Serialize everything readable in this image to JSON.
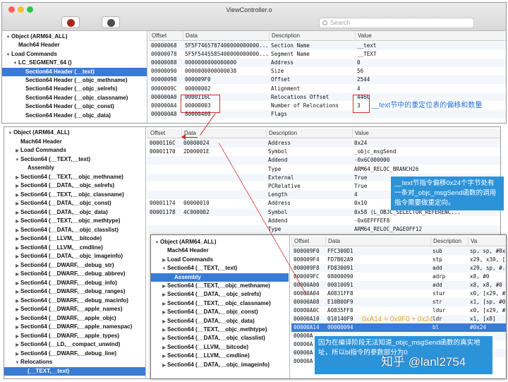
{
  "window": {
    "title": "ViewController.o",
    "search_placeholder": "Search"
  },
  "panel1": {
    "tree": [
      {
        "label": "Object (ARM64_ALL)",
        "arrow": "▼",
        "indent": 0
      },
      {
        "label": "Mach64 Header",
        "arrow": "",
        "indent": 1
      },
      {
        "label": "Load Commands",
        "arrow": "▼",
        "indent": 0
      },
      {
        "label": "LC_SEGMENT_64 ()",
        "arrow": "▼",
        "indent": 1
      },
      {
        "label": "Section64 Header (__text)",
        "arrow": "",
        "indent": 2,
        "selected": true
      },
      {
        "label": "Section64 Header (__objc_methname)",
        "arrow": "",
        "indent": 2
      },
      {
        "label": "Section64 Header (__objc_selrefs)",
        "arrow": "",
        "indent": 2
      },
      {
        "label": "Section64 Header (__objc_classname)",
        "arrow": "",
        "indent": 2
      },
      {
        "label": "Section64 Header (__objc_const)",
        "arrow": "",
        "indent": 2
      },
      {
        "label": "Section64 Header (__objc_data)",
        "arrow": "",
        "indent": 2
      }
    ],
    "columns": [
      "Offset",
      "Data",
      "Description",
      "Value"
    ],
    "rows": [
      [
        "00000068",
        "5F5F7465787400000000000...",
        "Section Name",
        "__text"
      ],
      [
        "00000078",
        "5F5F5445585400000000000...",
        "Segment Name",
        "__TEXT"
      ],
      [
        "00000088",
        "0000000000000000",
        "Address",
        "0"
      ],
      [
        "00000090",
        "0000000000000038",
        "Size",
        "56"
      ],
      [
        "00000098",
        "000009F0",
        "Offset",
        "2544"
      ],
      [
        "0000009C",
        "00000002",
        "Alignment",
        "4"
      ],
      [
        "000000A0",
        "0000116C",
        "Relocations Offset",
        "4460"
      ],
      [
        "000000A4",
        "00000003",
        "Number of Relocations",
        "3"
      ],
      [
        "000000A8",
        "80000400",
        "Flags",
        ""
      ]
    ]
  },
  "panel2": {
    "tree": [
      {
        "label": "Object (ARM64_ALL)",
        "arrow": "▼",
        "indent": 0
      },
      {
        "label": "Mach64 Header",
        "arrow": "",
        "indent": 1
      },
      {
        "label": "Load Commands",
        "arrow": "▶",
        "indent": 1
      },
      {
        "label": "Section64 (__TEXT,__text)",
        "arrow": "▼",
        "indent": 1
      },
      {
        "label": "Assembly",
        "arrow": "",
        "indent": 2
      },
      {
        "label": "Section64 (__TEXT,__objc_methname)",
        "arrow": "▶",
        "indent": 1
      },
      {
        "label": "Section64 (__DATA,__objc_selrefs)",
        "arrow": "▶",
        "indent": 1
      },
      {
        "label": "Section64 (__TEXT,__objc_classname)",
        "arrow": "▶",
        "indent": 1
      },
      {
        "label": "Section64 (__DATA,__objc_const)",
        "arrow": "▶",
        "indent": 1
      },
      {
        "label": "Section64 (__DATA,__objc_data)",
        "arrow": "▶",
        "indent": 1
      },
      {
        "label": "Section64 (__TEXT,__objc_methtype)",
        "arrow": "▶",
        "indent": 1
      },
      {
        "label": "Section64 (__DATA,__objc_classlist)",
        "arrow": "▶",
        "indent": 1
      },
      {
        "label": "Section64 (__LLVM,__bitcode)",
        "arrow": "▶",
        "indent": 1
      },
      {
        "label": "Section64 (__LLVM,__cmdline)",
        "arrow": "▶",
        "indent": 1
      },
      {
        "label": "Section64 (__DATA,__objc_imageinfo)",
        "arrow": "▶",
        "indent": 1
      },
      {
        "label": "Section64 (__DWARF,__debug_str)",
        "arrow": "▶",
        "indent": 1
      },
      {
        "label": "Section64 (__DWARF,__debug_abbrev)",
        "arrow": "▶",
        "indent": 1
      },
      {
        "label": "Section64 (__DWARF,__debug_info)",
        "arrow": "▶",
        "indent": 1
      },
      {
        "label": "Section64 (__DWARF,__debug_ranges)",
        "arrow": "▶",
        "indent": 1
      },
      {
        "label": "Section64 (__DWARF,__debug_macinfo)",
        "arrow": "▶",
        "indent": 1
      },
      {
        "label": "Section64 (__DWARF,__apple_names)",
        "arrow": "▶",
        "indent": 1
      },
      {
        "label": "Section64 (__DWARF,__apple_objc)",
        "arrow": "▶",
        "indent": 1
      },
      {
        "label": "Section64 (__DWARF,__apple_namespac)",
        "arrow": "▶",
        "indent": 1
      },
      {
        "label": "Section64 (__DWARF,__apple_types)",
        "arrow": "▶",
        "indent": 1
      },
      {
        "label": "Section64 (__LD,__compact_unwind)",
        "arrow": "▶",
        "indent": 1
      },
      {
        "label": "Section64 (__DWARF,__debug_line)",
        "arrow": "▶",
        "indent": 1
      },
      {
        "label": "Relocations",
        "arrow": "▼",
        "indent": 1
      },
      {
        "label": "(__TEXT,__text)",
        "arrow": "",
        "indent": 2,
        "selected": true
      }
    ],
    "columns": [
      "Offset",
      "Data",
      "Description",
      "Value"
    ],
    "rows": [
      [
        "0000116C",
        "00000024",
        "Address",
        "0x24"
      ],
      [
        "00001170",
        "2D00001E",
        "Symbol",
        "_objc_msgSend"
      ],
      [
        "",
        "",
        "Addend",
        "-0x6C000000"
      ],
      [
        "",
        "",
        "Type",
        "ARM64_RELOC_BRANCH26"
      ],
      [
        "",
        "",
        "External",
        "True"
      ],
      [
        "",
        "",
        "PCRelative",
        "True"
      ],
      [
        "",
        "",
        "Length",
        "4"
      ],
      [
        "00001174",
        "00000010",
        "Address",
        "0x10"
      ],
      [
        "00001178",
        "4C000002",
        "Symbol",
        "0x58 (L_OBJC_SELECTOR_REFERENC..."
      ],
      [
        "",
        "",
        "Addend",
        "-0x6EFFFEF8"
      ],
      [
        "",
        "",
        "Type",
        "ARM64_RELOC_PAGEOFF12"
      ]
    ]
  },
  "panel3": {
    "tree": [
      {
        "label": "Object (ARM64_ALL)",
        "arrow": "▼",
        "indent": 0
      },
      {
        "label": "Mach64 Header",
        "arrow": "",
        "indent": 1
      },
      {
        "label": "Load Commands",
        "arrow": "▶",
        "indent": 1
      },
      {
        "label": "Section64 (__TEXT,__text)",
        "arrow": "▼",
        "indent": 1
      },
      {
        "label": "Assembly",
        "arrow": "",
        "indent": 2,
        "selected": true
      },
      {
        "label": "Section64 (__TEXT,__objc_methname)",
        "arrow": "▶",
        "indent": 1
      },
      {
        "label": "Section64 (__DATA,__objc_selrefs)",
        "arrow": "▶",
        "indent": 1
      },
      {
        "label": "Section64 (__TEXT,__objc_classname)",
        "arrow": "▶",
        "indent": 1
      },
      {
        "label": "Section64 (__DATA,__objc_const)",
        "arrow": "▶",
        "indent": 1
      },
      {
        "label": "Section64 (__DATA,__objc_data)",
        "arrow": "▶",
        "indent": 1
      },
      {
        "label": "Section64 (__TEXT,__objc_methtype)",
        "arrow": "▶",
        "indent": 1
      },
      {
        "label": "Section64 (__DATA,__objc_classlist)",
        "arrow": "▶",
        "indent": 1
      },
      {
        "label": "Section64 (__LLVM,__bitcode)",
        "arrow": "▶",
        "indent": 1
      },
      {
        "label": "Section64 (__LLVM,__cmdline)",
        "arrow": "▶",
        "indent": 1
      },
      {
        "label": "Section64 (__DATA,__objc_imageinfo)",
        "arrow": "▶",
        "indent": 1
      }
    ],
    "columns": [
      "Offset",
      "Data",
      "Description",
      "Va"
    ],
    "rows": [
      [
        "000009F0",
        "FFC300D1",
        "sub",
        "sp, sp, #0x..."
      ],
      [
        "000009F4",
        "FD7B02A9",
        "stp",
        "x29, x30, [..."
      ],
      [
        "000009F8",
        "FD830091",
        "add",
        "x29, sp, #..."
      ],
      [
        "000009FC",
        "08000090",
        "adrp",
        "x8, #0"
      ],
      [
        "00000A00",
        "00010091",
        "add",
        "x8, x8, #0"
      ],
      [
        "00000A04",
        "A0831FF8",
        "stur",
        "x0, [x29, #..."
      ],
      [
        "00000A08",
        "E10B00F9",
        "str",
        "x1, [sp, #0..."
      ],
      [
        "00000A0C",
        "A0835FF8",
        "ldur",
        "x0, [x29, #..."
      ],
      [
        "00000A10",
        "010140F9",
        "ldr",
        "x1, [x8]"
      ],
      [
        "00000A14",
        "00000094",
        "bl",
        "#0x24"
      ],
      [
        "00000A",
        "",
        "",
        ""
      ],
      [
        "00000A",
        "",
        "",
        ""
      ],
      [
        "00000A",
        "",
        "",
        ""
      ],
      [
        "00000A",
        "",
        "",
        ""
      ]
    ]
  },
  "annotations": {
    "note1": "__text节中的重定位表的偏移和数量",
    "note2": "__text节指令偏移0x24个字节处有一条对_objc_msgSend函数的调用指令需要做重定向。",
    "note3": "0xA14 = 0x9F0 + 0x24",
    "note4": "因为在编译阶段无法知道_objc_msgSend函数的真实地址，所以bl指令的参数部分为0",
    "watermark": "知乎 @lanl2754"
  },
  "colors": {
    "selection": "#3a7bd5",
    "callout": "#2d93d9",
    "note_text": "#1f6fd6",
    "red_marker": "#d03030"
  }
}
